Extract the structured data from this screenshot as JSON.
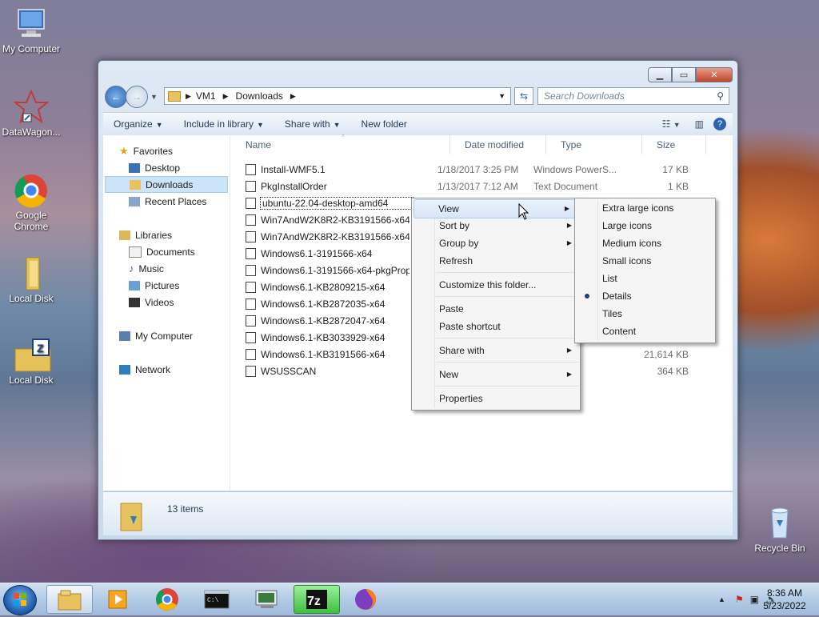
{
  "desktop": {
    "icons": [
      {
        "label": "My Computer",
        "name": "my-computer-icon"
      },
      {
        "label": "DataWagon...",
        "name": "datawagon-icon"
      },
      {
        "label": "Google Chrome",
        "name": "google-chrome-icon"
      },
      {
        "label": "Local Disk",
        "name": "local-disk-icon"
      },
      {
        "label": "Local Disk",
        "name": "local-disk-7z-icon"
      },
      {
        "label": "Recycle Bin",
        "name": "recycle-bin-icon"
      }
    ]
  },
  "window": {
    "breadcrumb": [
      "VM1",
      "Downloads"
    ],
    "search_placeholder": "Search Downloads",
    "toolbar": {
      "organize": "Organize",
      "include": "Include in library",
      "share": "Share with",
      "new_folder": "New folder"
    },
    "nav": {
      "favorites": "Favorites",
      "desktop": "Desktop",
      "downloads": "Downloads",
      "recent": "Recent Places",
      "libraries": "Libraries",
      "documents": "Documents",
      "music": "Music",
      "pictures": "Pictures",
      "videos": "Videos",
      "computer": "My Computer",
      "network": "Network"
    },
    "columns": {
      "name": "Name",
      "date": "Date modified",
      "type": "Type",
      "size": "Size"
    },
    "files": [
      {
        "name": "Install-WMF5.1",
        "date": "1/18/2017 3:25 PM",
        "type": "Windows PowerS...",
        "size": "17 KB"
      },
      {
        "name": "PkgInstallOrder",
        "date": "1/13/2017 7:12 AM",
        "type": "Text Document",
        "size": "1 KB"
      },
      {
        "name": "ubuntu-22.04-desktop-amd64",
        "date": "",
        "type": "",
        "size": ""
      },
      {
        "name": "Win7AndW2K8R2-KB3191566-x64",
        "date": "",
        "type": "",
        "size": ""
      },
      {
        "name": "Win7AndW2K8R2-KB3191566-x64",
        "date": "",
        "type": "",
        "size": ""
      },
      {
        "name": "Windows6.1-3191566-x64",
        "date": "",
        "type": "",
        "size": ""
      },
      {
        "name": "Windows6.1-3191566-x64-pkgPrope",
        "date": "",
        "type": "",
        "size": ""
      },
      {
        "name": "Windows6.1-KB2809215-x64",
        "date": "",
        "type": "",
        "size": ""
      },
      {
        "name": "Windows6.1-KB2872035-x64",
        "date": "",
        "type": "",
        "size": ""
      },
      {
        "name": "Windows6.1-KB2872047-x64",
        "date": "",
        "type": "",
        "size": ""
      },
      {
        "name": "Windows6.1-KB3033929-x64",
        "date": "",
        "type": "",
        "size": ""
      },
      {
        "name": "Windows6.1-KB3191566-x64",
        "date": "",
        "type": "chive",
        "size": "21,614 KB"
      },
      {
        "name": "WSUSSCAN",
        "date": "",
        "type": "chive",
        "size": "364 KB"
      }
    ],
    "status": "13 items"
  },
  "context_menu": {
    "items": [
      "View",
      "Sort by",
      "Group by",
      "Refresh",
      "Customize this folder...",
      "Paste",
      "Paste shortcut",
      "Share with",
      "New",
      "Properties"
    ]
  },
  "view_submenu": {
    "items": [
      "Extra large icons",
      "Large icons",
      "Medium icons",
      "Small icons",
      "List",
      "Details",
      "Tiles",
      "Content"
    ],
    "selected": "Details"
  },
  "taskbar": {
    "time": "8:36 AM",
    "date": "5/23/2022"
  }
}
